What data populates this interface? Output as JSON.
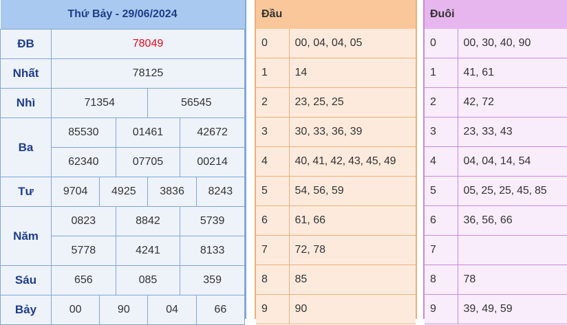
{
  "results": {
    "title": "Thứ Bảy - 29/06/2024",
    "labels": {
      "db": "ĐB",
      "nhat": "Nhất",
      "nhi": "Nhì",
      "ba": "Ba",
      "tu": "Tư",
      "nam": "Năm",
      "sau": "Sáu",
      "bay": "Bảy"
    },
    "db": "78049",
    "nhat": "78125",
    "nhi": [
      "71354",
      "56545"
    ],
    "ba": [
      "85530",
      "01461",
      "42672",
      "62340",
      "07705",
      "00214"
    ],
    "tu": [
      "9704",
      "4925",
      "3836",
      "8243"
    ],
    "nam": [
      "0823",
      "8842",
      "5739",
      "5778",
      "4241",
      "8133"
    ],
    "sau": [
      "656",
      "085",
      "359"
    ],
    "bay": [
      "00",
      "90",
      "04",
      "66"
    ]
  },
  "dau": {
    "header": "Đầu",
    "rows": [
      {
        "k": "0",
        "v": "00, 04, 04, 05"
      },
      {
        "k": "1",
        "v": "14"
      },
      {
        "k": "2",
        "v": "23, 25, 25"
      },
      {
        "k": "3",
        "v": "30, 33, 36, 39"
      },
      {
        "k": "4",
        "v": "40, 41, 42, 43, 45, 49"
      },
      {
        "k": "5",
        "v": "54, 56, 59"
      },
      {
        "k": "6",
        "v": "61, 66"
      },
      {
        "k": "7",
        "v": "72, 78"
      },
      {
        "k": "8",
        "v": "85"
      },
      {
        "k": "9",
        "v": "90"
      }
    ]
  },
  "duoi": {
    "header": "Đuôi",
    "rows": [
      {
        "k": "0",
        "v": "00, 30, 40, 90"
      },
      {
        "k": "1",
        "v": "41, 61"
      },
      {
        "k": "2",
        "v": "42, 72"
      },
      {
        "k": "3",
        "v": "23, 33, 43"
      },
      {
        "k": "4",
        "v": "04, 04, 14, 54"
      },
      {
        "k": "5",
        "v": "05, 25, 25, 45, 85"
      },
      {
        "k": "6",
        "v": "36, 56, 66"
      },
      {
        "k": "7",
        "v": ""
      },
      {
        "k": "8",
        "v": "78"
      },
      {
        "k": "9",
        "v": "39, 49, 59"
      }
    ]
  },
  "colors": {
    "results_header": "#a9c9f0",
    "special_prize": "#e8091b",
    "dau_header": "#f9c79a",
    "duoi_header": "#e7b6ef"
  }
}
